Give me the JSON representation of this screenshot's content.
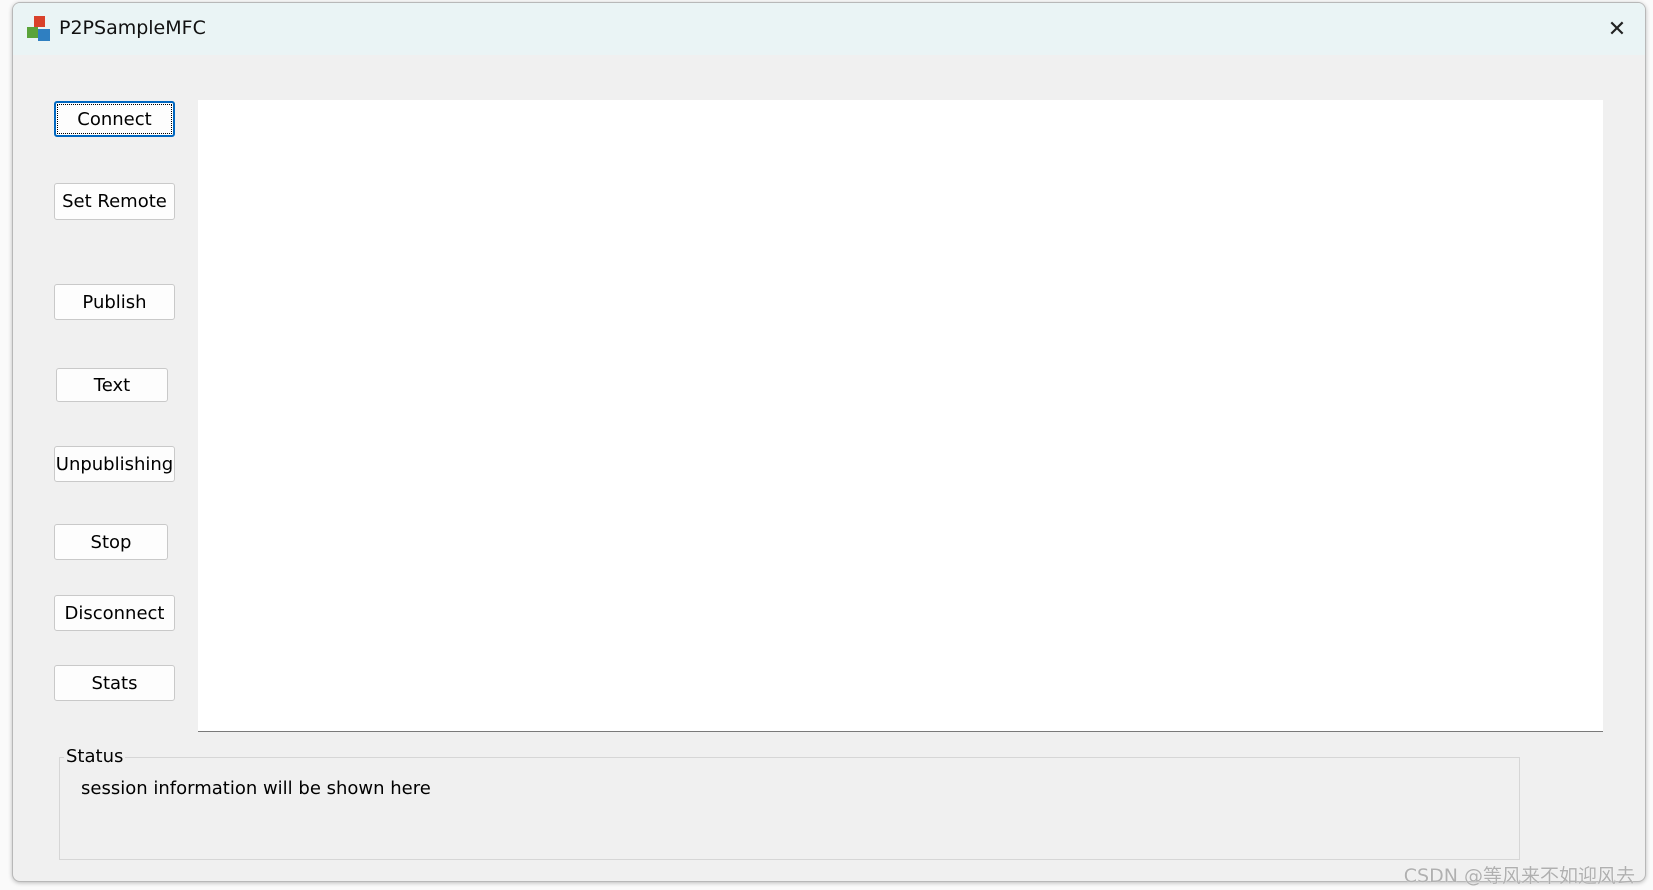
{
  "window": {
    "title": "P2PSampleMFC",
    "close_icon": "close-icon"
  },
  "buttons": {
    "connect": "Connect",
    "set_remote": "Set Remote",
    "publish": "Publish",
    "text": "Text",
    "unpublishing": "Unpublishing",
    "stop": "Stop",
    "disconnect": "Disconnect",
    "stats": "Stats"
  },
  "status": {
    "label": "Status",
    "text": "session information will be shown here"
  },
  "watermark": "CSDN @等风来不如迎风去"
}
